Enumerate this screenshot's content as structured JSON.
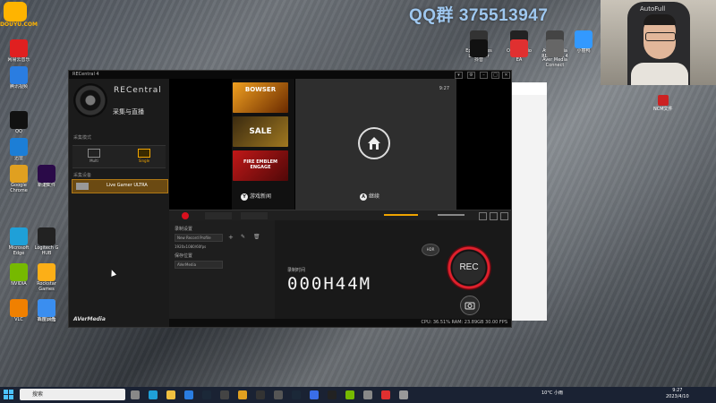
{
  "overlay": {
    "qq_group": "QQ群 375513947",
    "douyu": "DOUYU.COM",
    "webcam_brand": "AutoFull",
    "ncm_label": "NCM文件"
  },
  "desktop_icons": [
    {
      "label": "网易云音乐",
      "color": "#e02020"
    },
    {
      "label": "腾讯视频",
      "color": "#2a7de1"
    },
    {
      "label": "QQ",
      "color": "#111"
    },
    {
      "label": "迅雷",
      "color": "#1c7ed6"
    },
    {
      "label": "Google Chrome",
      "color": "#e0a020"
    },
    {
      "label": "新建文件",
      "color": "#fff"
    },
    {
      "label": "Microsoft Edge",
      "color": "#1fa0d8"
    },
    {
      "label": "NVIDIA",
      "color": "#76b900"
    },
    {
      "label": "VLC",
      "color": "#f08000"
    },
    {
      "label": "截图.png",
      "color": "#bbb"
    },
    {
      "label": "PR",
      "color": "#2a0a48"
    },
    {
      "label": "Logitech G HUB",
      "color": "#222"
    },
    {
      "label": "Rockstar Games Launcher",
      "color": "#fcaf17"
    },
    {
      "label": "百度网盘",
      "color": "#3a8ef0"
    },
    {
      "label": "Epic Games Launcher",
      "color": "#333"
    },
    {
      "label": "OBS Studio",
      "color": "#222"
    },
    {
      "label": "Aver Media RECentral 4",
      "color": "#444"
    },
    {
      "label": "小丽鸭",
      "color": "#3399ff"
    },
    {
      "label": "抖音",
      "color": "#111"
    },
    {
      "label": "EA",
      "color": "#e03030"
    },
    {
      "label": "Aver Media Connect",
      "color": "#666"
    }
  ],
  "recentral": {
    "window_title": "RECentral 4",
    "brand": "RECentral",
    "subtitle": "采集与直播",
    "section_mode": "采集模式",
    "mode_multi": "Multi",
    "mode_single": "Single",
    "section_device": "采集设备",
    "device_name": "Live Gamer ULTRA",
    "logo": "AVerMedia",
    "record_section": "录制设置",
    "profile": "New Record Profile",
    "resolution": "1920x1080/60fps",
    "save_to_label": "保存位置",
    "save_path": "AVerMedia",
    "timer_label": "录制时间",
    "timer": "000H44M",
    "rec": "REC",
    "hdr": "HDR",
    "status": "CPU: 36.51%   RAM: 23.89GB   30.00 FPS"
  },
  "switch": {
    "tile1": "BOWSER",
    "tile2": "SALE",
    "tile3": "FIRE EMBLEM ENGAGE",
    "hint_left": "游戏新闻",
    "hint_right": "继续",
    "hint_left_btn": "Y",
    "hint_right_btn": "A",
    "clock": "9:27"
  },
  "taskbar": {
    "search_placeholder": "搜索",
    "weather": "10°C 小雨",
    "time": "9:27",
    "date": "2023/4/10"
  }
}
